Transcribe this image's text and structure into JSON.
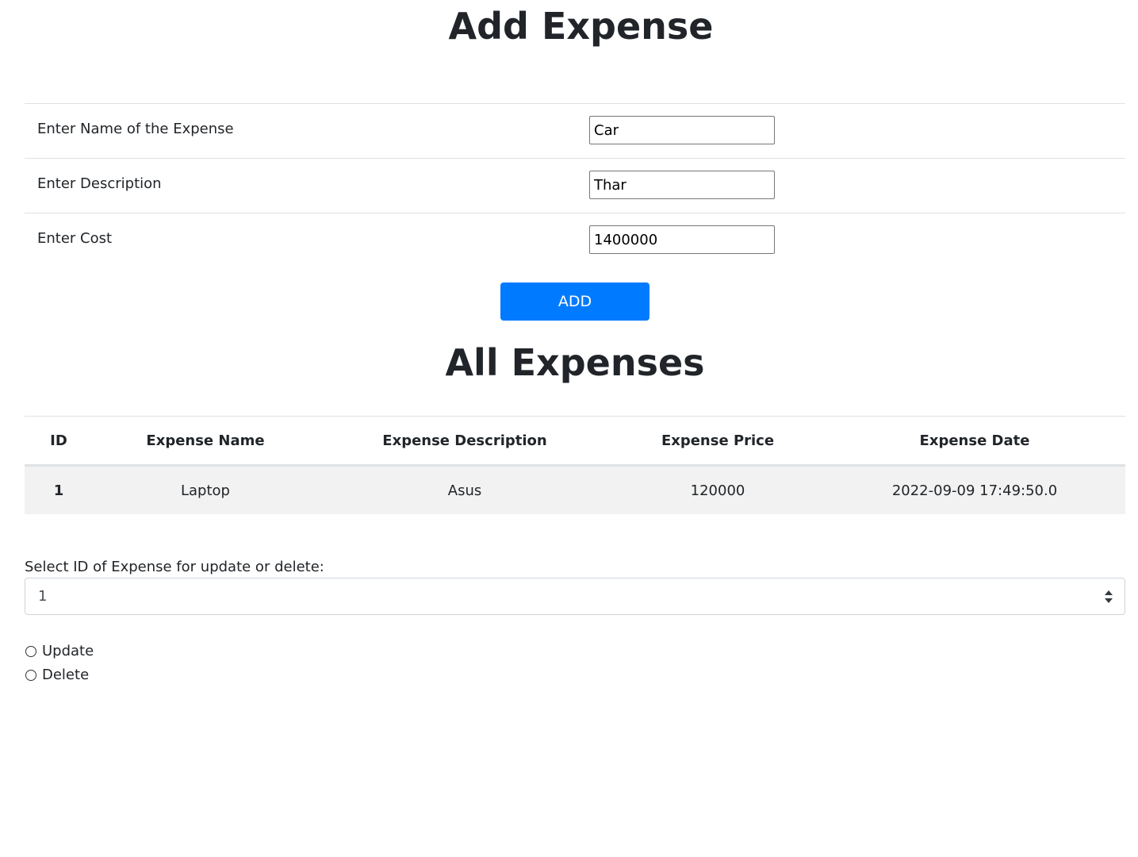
{
  "add_section": {
    "title": "Add Expense",
    "fields": [
      {
        "label": "Enter Name of the Expense",
        "value": "Car"
      },
      {
        "label": "Enter Description",
        "value": "Thar"
      },
      {
        "label": "Enter Cost",
        "value": "1400000"
      }
    ],
    "add_button_label": "ADD",
    "accent_color": "#007bff"
  },
  "list_section": {
    "title": "All Expenses",
    "columns": [
      "ID",
      "Expense Name",
      "Expense Description",
      "Expense Price",
      "Expense Date"
    ],
    "rows": [
      [
        "1",
        "Laptop",
        "Asus",
        "120000",
        "2022-09-09 17:49:50.0"
      ]
    ]
  },
  "action_section": {
    "select_label": "Select ID of Expense for update or delete:",
    "selected_id": "1",
    "options": [
      {
        "label": "Update"
      },
      {
        "label": "Delete"
      }
    ]
  }
}
